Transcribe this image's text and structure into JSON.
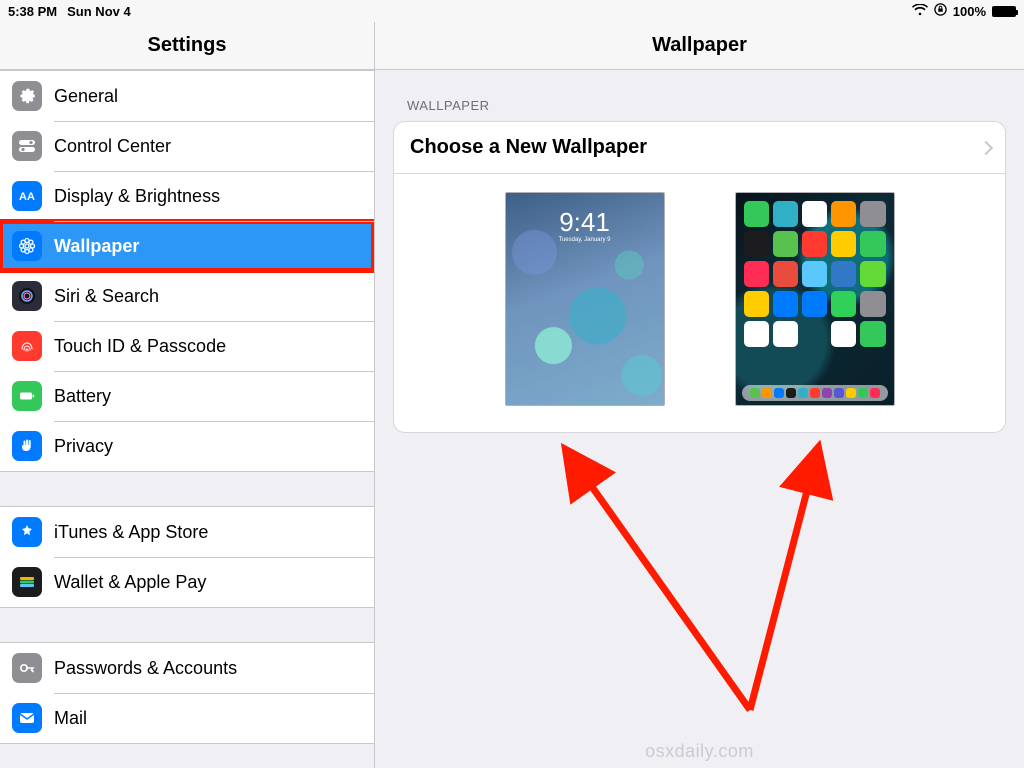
{
  "statusbar": {
    "time": "5:38 PM",
    "date": "Sun Nov 4",
    "battery_pct": "100%"
  },
  "header": {
    "left_title": "Settings",
    "right_title": "Wallpaper"
  },
  "sidebar": {
    "groups": [
      {
        "items": [
          {
            "key": "general",
            "label": "General",
            "icon": "gear-icon",
            "icon_cls": "ic-gray",
            "active": false
          },
          {
            "key": "control",
            "label": "Control Center",
            "icon": "switch-icon",
            "icon_cls": "ic-gray",
            "active": false
          },
          {
            "key": "display",
            "label": "Display & Brightness",
            "icon": "brightness-icon",
            "icon_cls": "ic-blue",
            "active": false
          },
          {
            "key": "wallpaper",
            "label": "Wallpaper",
            "icon": "flower-icon",
            "icon_cls": "ic-blue",
            "active": true,
            "highlight": true
          },
          {
            "key": "siri",
            "label": "Siri & Search",
            "icon": "siri-icon",
            "icon_cls": "ic-darkbl",
            "active": false
          },
          {
            "key": "touchid",
            "label": "Touch ID & Passcode",
            "icon": "fingerprint-icon",
            "icon_cls": "ic-red",
            "active": false
          },
          {
            "key": "battery",
            "label": "Battery",
            "icon": "battery-icon",
            "icon_cls": "ic-green",
            "active": false
          },
          {
            "key": "privacy",
            "label": "Privacy",
            "icon": "hand-icon",
            "icon_cls": "ic-blue",
            "active": false
          }
        ]
      },
      {
        "items": [
          {
            "key": "itunes",
            "label": "iTunes & App Store",
            "icon": "appstore-icon",
            "icon_cls": "ic-blue",
            "active": false
          },
          {
            "key": "wallet",
            "label": "Wallet & Apple Pay",
            "icon": "wallet-icon",
            "icon_cls": "ic-wallet",
            "active": false
          }
        ]
      },
      {
        "items": [
          {
            "key": "passwords",
            "label": "Passwords & Accounts",
            "icon": "key-icon",
            "icon_cls": "ic-key",
            "active": false
          },
          {
            "key": "mail",
            "label": "Mail",
            "icon": "mail-icon",
            "icon_cls": "ic-blue",
            "active": false
          }
        ]
      }
    ]
  },
  "detail": {
    "section_title": "WALLPAPER",
    "choose_label": "Choose a New Wallpaper",
    "lock_preview": {
      "time": "9:41",
      "date": "Tuesday, January 9"
    }
  },
  "watermark": "osxdaily.com",
  "annotation": {
    "highlight_color": "#ff1b00",
    "arrows_point_to": [
      "lock-screen-preview",
      "home-screen-preview"
    ]
  }
}
